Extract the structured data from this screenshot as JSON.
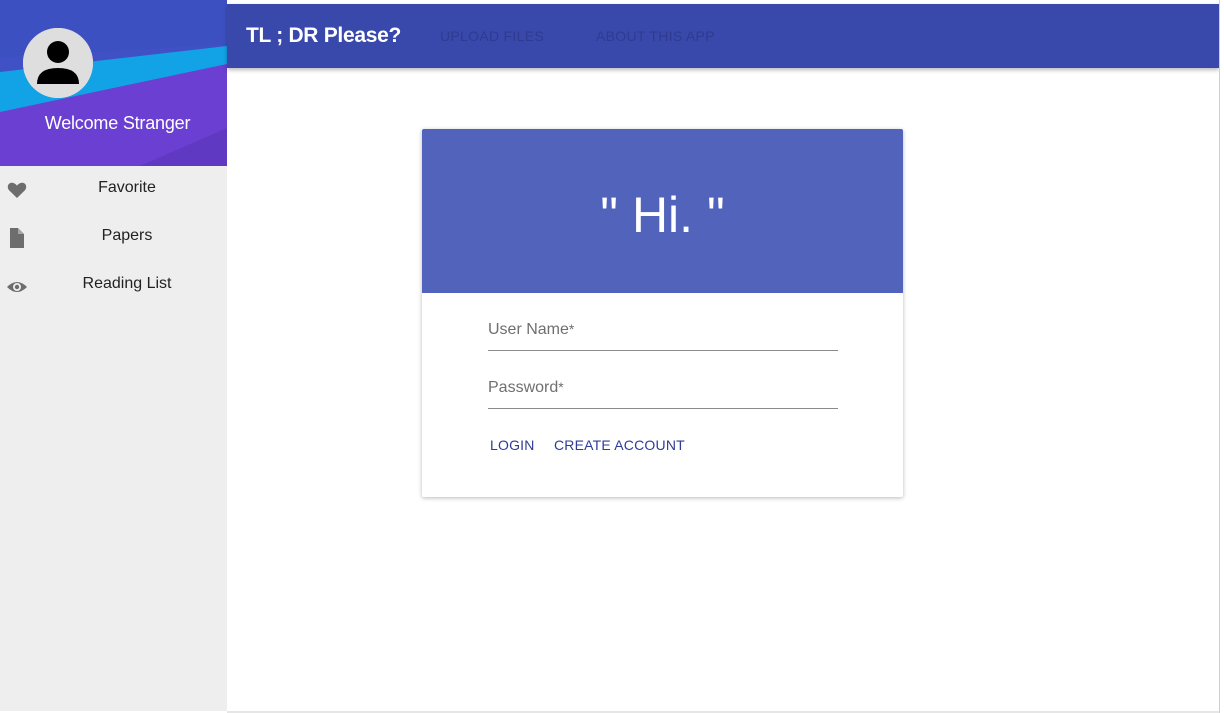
{
  "sidebar": {
    "welcome": "Welcome Stranger",
    "items": [
      {
        "label": "Favorite",
        "icon": "heart-icon"
      },
      {
        "label": "Papers",
        "icon": "document-icon"
      },
      {
        "label": "Reading List",
        "icon": "eye-icon"
      }
    ]
  },
  "appbar": {
    "title": "TL ; DR Please?",
    "links": [
      "UPLOAD FILES",
      "ABOUT THIS APP"
    ]
  },
  "login_card": {
    "greeting": "\" Hi. \"",
    "username_label": "User Name",
    "password_label": "Password",
    "required_marker": "*",
    "login_label": "LOGIN",
    "create_account_label": "CREATE ACCOUNT"
  },
  "colors": {
    "appbar": "#3949ab",
    "card_header": "#5163bb",
    "sidebar_bg": "#eeeeee",
    "link_text": "#2f3b96",
    "header_cyan": "#12a3e6",
    "header_purple": "#6a3fd1"
  }
}
